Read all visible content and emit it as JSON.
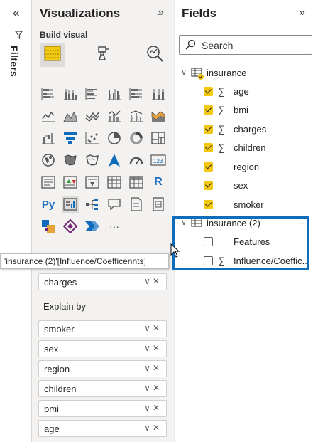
{
  "filters_pane": {
    "label": "Filters",
    "collapse_glyph": "«"
  },
  "viz_pane": {
    "title": "Visualizations",
    "expand_glyph": "»",
    "build_visual": "Build visual",
    "more_glyph": "···",
    "r_label": "R",
    "py_label": "Py",
    "kpi_label": "123"
  },
  "tooltip": {
    "text": "'insurance (2)'[Influence/Coefficennts]"
  },
  "wells": {
    "analyze_value": "charges",
    "explain_label": "Explain by",
    "explain_items": [
      "smoker",
      "sex",
      "region",
      "children",
      "bmi",
      "age"
    ],
    "control_glyphs": "∨✕"
  },
  "fields_pane": {
    "title": "Fields",
    "expand_glyph": "»",
    "search_placeholder": "Search",
    "table1": {
      "name": "insurance",
      "fields": [
        {
          "name": "age",
          "checked": true,
          "sigma": true
        },
        {
          "name": "bmi",
          "checked": true,
          "sigma": true
        },
        {
          "name": "charges",
          "checked": true,
          "sigma": true
        },
        {
          "name": "children",
          "checked": true,
          "sigma": true
        },
        {
          "name": "region",
          "checked": true,
          "sigma": false
        },
        {
          "name": "sex",
          "checked": true,
          "sigma": false
        },
        {
          "name": "smoker",
          "checked": true,
          "sigma": false
        }
      ]
    },
    "table2": {
      "name": "insurance (2)",
      "dots": "··",
      "fields": [
        {
          "name": "Features",
          "checked": false,
          "sigma": false
        },
        {
          "name": "Influence/Coeffic...",
          "checked": false,
          "sigma": true
        }
      ]
    },
    "sigma_glyph": "∑",
    "chevron_glyph": "∨"
  },
  "colors": {
    "accent_yellow": "#f2c811",
    "highlight_blue": "#0f6cbd"
  }
}
